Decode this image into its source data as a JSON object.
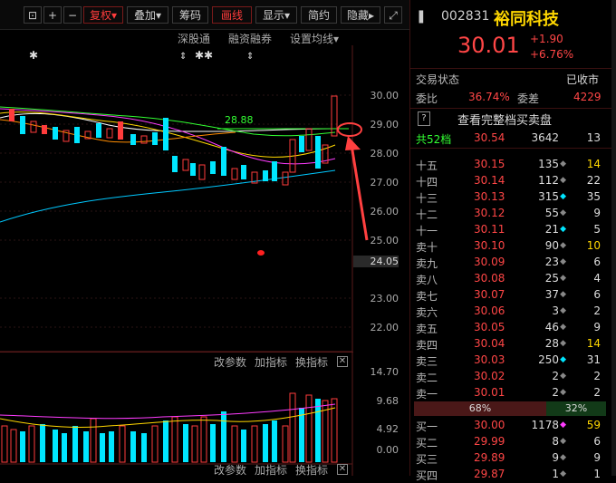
{
  "toolbar": {
    "items": [
      "复权",
      "叠加",
      "筹码",
      "画线",
      "显示",
      "简约",
      "隐藏"
    ],
    "more": "▸"
  },
  "chart_top": {
    "links": [
      "深股通",
      "融资融券",
      "设置均线"
    ],
    "price_label": "28.88",
    "y_ticks": [
      "30.00",
      "29.00",
      "28.00",
      "27.00",
      "26.00",
      "25.00",
      "24.05",
      "23.00",
      "22.00"
    ],
    "current_price_tag": "24.05"
  },
  "indicator_bar_1": {
    "items": [
      "改参数",
      "加指标",
      "换指标"
    ]
  },
  "indicator_bar_2": {
    "items": [
      "改参数",
      "加指标",
      "换指标"
    ]
  },
  "volume_ticks": [
    "14.70",
    "9.68",
    "4.92",
    "0.00"
  ],
  "volume_unit": "万",
  "stock": {
    "code": "002831",
    "name": "裕同科技",
    "price": "30.01",
    "change": "+1.90",
    "change_pct": "+6.76%"
  },
  "status": {
    "label": "交易状态",
    "value": "已收市"
  },
  "ratio": {
    "wb_label": "委比",
    "wb_value": "36.74%",
    "wc_label": "委差",
    "wc_value": "4229"
  },
  "full_order_link": "查看完整档买卖盘",
  "summary_row": {
    "label": "共52档",
    "price": "30.54",
    "vol": "3642",
    "count": "13"
  },
  "asks": [
    {
      "label": "十五",
      "price": "30.15",
      "vol": "135",
      "mark": "◆",
      "count": "14"
    },
    {
      "label": "十四",
      "price": "30.14",
      "vol": "112",
      "mark": "◆",
      "count": "22"
    },
    {
      "label": "十三",
      "price": "30.13",
      "vol": "315",
      "mark": "◆",
      "count": "35"
    },
    {
      "label": "十二",
      "price": "30.12",
      "vol": "55",
      "mark": "◆",
      "count": "9"
    },
    {
      "label": "十一",
      "price": "30.11",
      "vol": "21",
      "mark": "◆",
      "count": "5"
    },
    {
      "label": "卖十",
      "price": "30.10",
      "vol": "90",
      "mark": "◆",
      "count": "10"
    },
    {
      "label": "卖九",
      "price": "30.09",
      "vol": "23",
      "mark": "◆",
      "count": "6"
    },
    {
      "label": "卖八",
      "price": "30.08",
      "vol": "25",
      "mark": "◆",
      "count": "4"
    },
    {
      "label": "卖七",
      "price": "30.07",
      "vol": "37",
      "mark": "◆",
      "count": "6"
    },
    {
      "label": "卖六",
      "price": "30.06",
      "vol": "3",
      "mark": "◆",
      "count": "2"
    },
    {
      "label": "卖五",
      "price": "30.05",
      "vol": "46",
      "mark": "◆",
      "count": "9"
    },
    {
      "label": "卖四",
      "price": "30.04",
      "vol": "28",
      "mark": "◆",
      "count": "14"
    },
    {
      "label": "卖三",
      "price": "30.03",
      "vol": "250",
      "mark": "◆",
      "count": "31"
    },
    {
      "label": "卖二",
      "price": "30.02",
      "vol": "2",
      "mark": "◆",
      "count": "2"
    },
    {
      "label": "卖一",
      "price": "30.01",
      "vol": "2",
      "mark": "◆",
      "count": "2"
    }
  ],
  "balance": {
    "sell_pct": "68%",
    "buy_pct": "32%"
  },
  "bids": [
    {
      "label": "买一",
      "price": "30.00",
      "vol": "1178",
      "mark": "◆",
      "count": "59"
    },
    {
      "label": "买二",
      "price": "29.99",
      "vol": "8",
      "mark": "◆",
      "count": "6"
    },
    {
      "label": "买三",
      "price": "29.89",
      "vol": "9",
      "mark": "◆",
      "count": "9"
    },
    {
      "label": "买四",
      "price": "29.87",
      "vol": "1",
      "mark": "◆",
      "count": "1"
    }
  ],
  "colors": {
    "up": "#ff3c3c",
    "down": "#00e6ff",
    "accent": "#ffd700"
  }
}
